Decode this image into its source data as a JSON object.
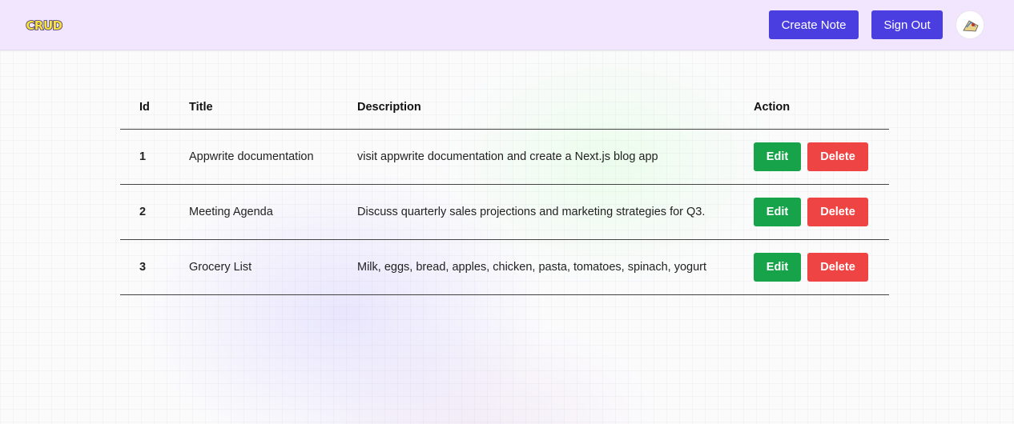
{
  "header": {
    "logo_text": "CRUD",
    "create_note_label": "Create Note",
    "sign_out_label": "Sign Out"
  },
  "table": {
    "columns": [
      "Id",
      "Title",
      "Description",
      "Action"
    ],
    "rows": [
      {
        "id": "1",
        "title": "Appwrite documentation",
        "description": "visit appwrite documentation and create a Next.js blog app"
      },
      {
        "id": "2",
        "title": "Meeting Agenda",
        "description": "Discuss quarterly sales projections and marketing strategies for Q3."
      },
      {
        "id": "3",
        "title": "Grocery List",
        "description": "Milk, eggs, bread, apples, chicken, pasta, tomatoes, spinach, yogurt"
      }
    ],
    "edit_label": "Edit",
    "delete_label": "Delete"
  },
  "colors": {
    "header_bg": "#f1e6fd",
    "primary_button": "#4a3ee0",
    "edit_button": "#16a34a",
    "delete_button": "#ef4444"
  },
  "icons": {
    "avatar": "user-avatar"
  }
}
